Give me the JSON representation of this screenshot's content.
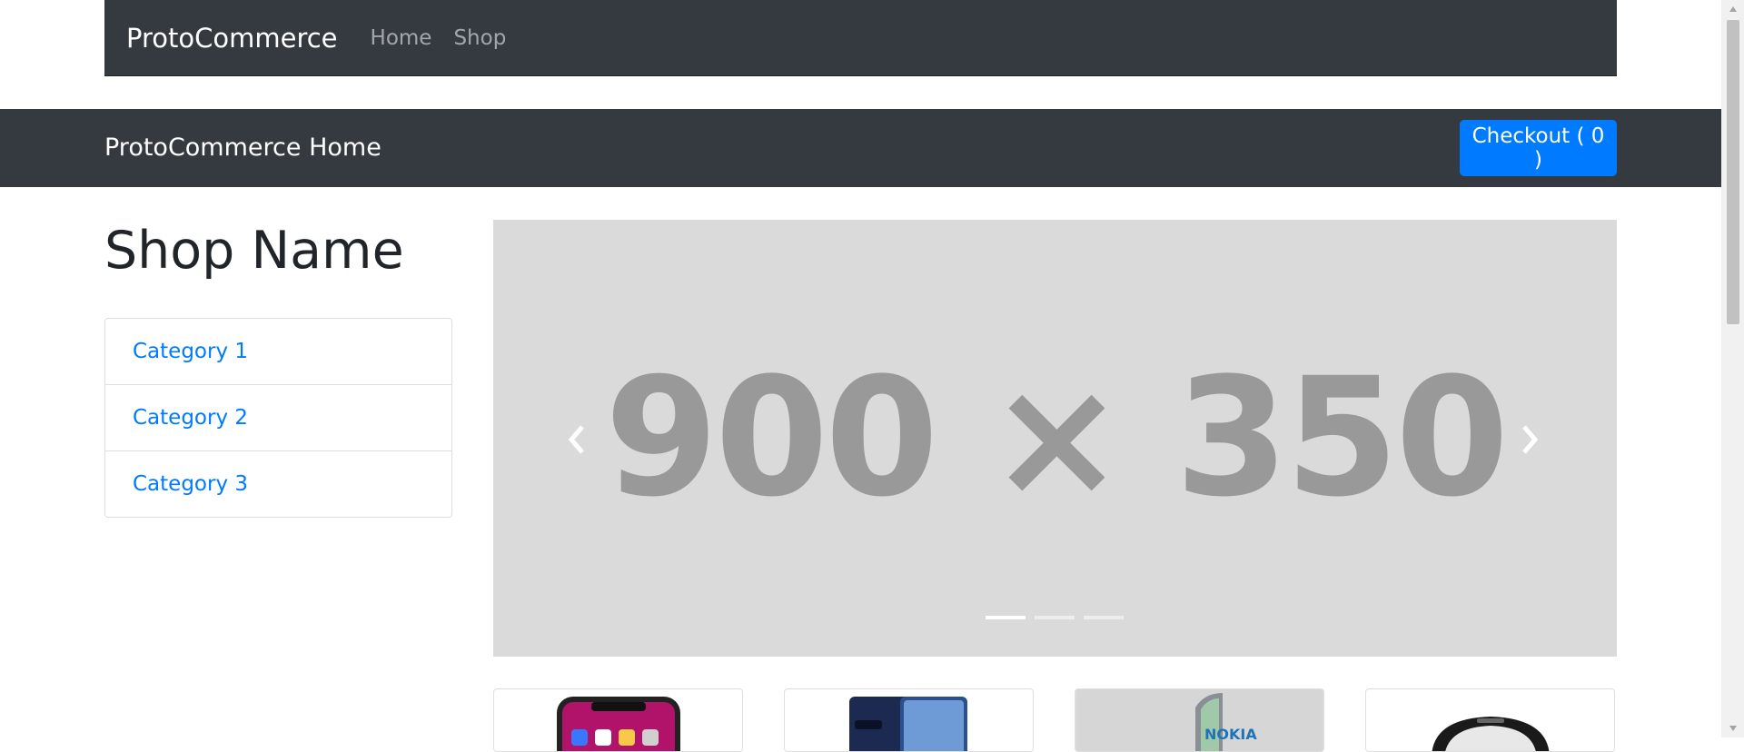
{
  "navbar": {
    "brand": "ProtoCommerce",
    "links": [
      {
        "label": "Home"
      },
      {
        "label": "Shop"
      }
    ]
  },
  "header": {
    "title": "ProtoCommerce Home",
    "checkout_label": "Checkout ( 0 )"
  },
  "sidebar": {
    "shop_name": "Shop Name",
    "categories": [
      {
        "label": "Category 1"
      },
      {
        "label": "Category 2"
      },
      {
        "label": "Category 3"
      }
    ]
  },
  "carousel": {
    "placeholder_text": "900 × 350",
    "prev_icon": "chevron-left-icon",
    "next_icon": "chevron-right-icon",
    "slide_count": 3,
    "active_slide": 1
  },
  "products": [
    {
      "image": "iphone-x-image"
    },
    {
      "image": "samsung-note8-image"
    },
    {
      "image": "nokia-edge-image"
    },
    {
      "image": "blackberry-image"
    }
  ],
  "colors": {
    "navbar_bg": "#343a40",
    "primary": "#007bff",
    "carousel_bg": "#dadada",
    "placeholder_text": "#999999"
  }
}
